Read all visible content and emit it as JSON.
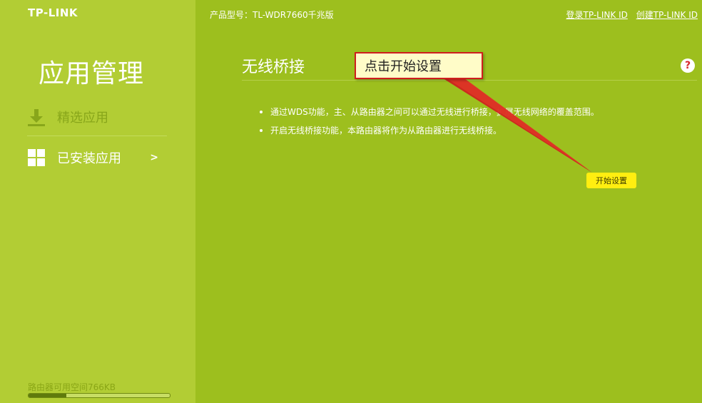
{
  "sidebar": {
    "logo": "TP-LINK",
    "title": "应用管理",
    "items": [
      {
        "label": "精选应用",
        "icon": "download-icon"
      },
      {
        "label": "已安装应用",
        "icon": "grid-icon",
        "chevron": ">"
      }
    ],
    "storage": {
      "label": "路由器可用空间766KB",
      "used_fraction": 0.27
    }
  },
  "header": {
    "model": "产品型号：TL-WDR7660千兆版",
    "login_link": "登录TP-LINK ID",
    "create_link": "创建TP-LINK ID"
  },
  "main": {
    "section_title": "无线桥接",
    "help_label": "?",
    "bullets": [
      "通过WDS功能，主、从路由器之间可以通过无线进行桥接，扩展无线网络的覆盖范围。",
      "开启无线桥接功能，本路由器将作为从路由器进行无线桥接。"
    ],
    "start_button": "开始设置"
  },
  "annotation": {
    "callout_text": "点击开始设置"
  },
  "colors": {
    "sidebar_bg": "#b2cd34",
    "main_bg": "#9dbf1e",
    "button_yellow": "#ffee10",
    "annotation_red": "#cf1e1e"
  }
}
